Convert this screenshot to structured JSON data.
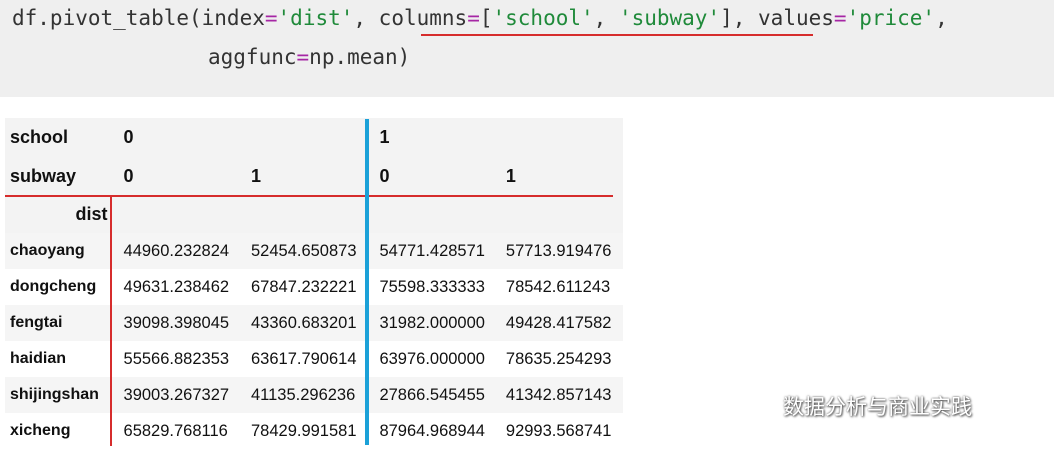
{
  "code": {
    "line1": {
      "p1": "df.pivot_table(index",
      "eq": "=",
      "s1": "'dist'",
      "p2": ", columns",
      "eq2": "=",
      "p3": "[",
      "s2": "'school'",
      "p4": ", ",
      "s3": "'subway'",
      "p5": "], values",
      "eq3": "=",
      "s4": "'price'",
      "p6": ","
    },
    "line2": {
      "p1": "aggfunc",
      "eq": "=",
      "p2": "np.mean)"
    }
  },
  "table": {
    "school_label": "school",
    "school_0": "0",
    "school_1": "1",
    "subway_label": "subway",
    "subway_values": [
      "0",
      "1",
      "0",
      "1"
    ],
    "index_label": "dist",
    "rows": [
      {
        "dist": "chaoyang",
        "v": [
          "44960.232824",
          "52454.650873",
          "54771.428571",
          "57713.919476"
        ]
      },
      {
        "dist": "dongcheng",
        "v": [
          "49631.238462",
          "67847.232221",
          "75598.333333",
          "78542.611243"
        ]
      },
      {
        "dist": "fengtai",
        "v": [
          "39098.398045",
          "43360.683201",
          "31982.000000",
          "49428.417582"
        ]
      },
      {
        "dist": "haidian",
        "v": [
          "55566.882353",
          "63617.790614",
          "63976.000000",
          "78635.254293"
        ]
      },
      {
        "dist": "shijingshan",
        "v": [
          "39003.267327",
          "41135.296236",
          "27866.545455",
          "41342.857143"
        ]
      },
      {
        "dist": "xicheng",
        "v": [
          "65829.768116",
          "78429.991581",
          "87964.968944",
          "92993.568741"
        ]
      }
    ]
  },
  "watermark": {
    "icon": "wechat-icon",
    "text": "数据分析与商业实践"
  },
  "colors": {
    "annotation_red": "#d62c2c",
    "annotation_blue": "#1ba1d8",
    "string_green": "#1f8a3a"
  }
}
